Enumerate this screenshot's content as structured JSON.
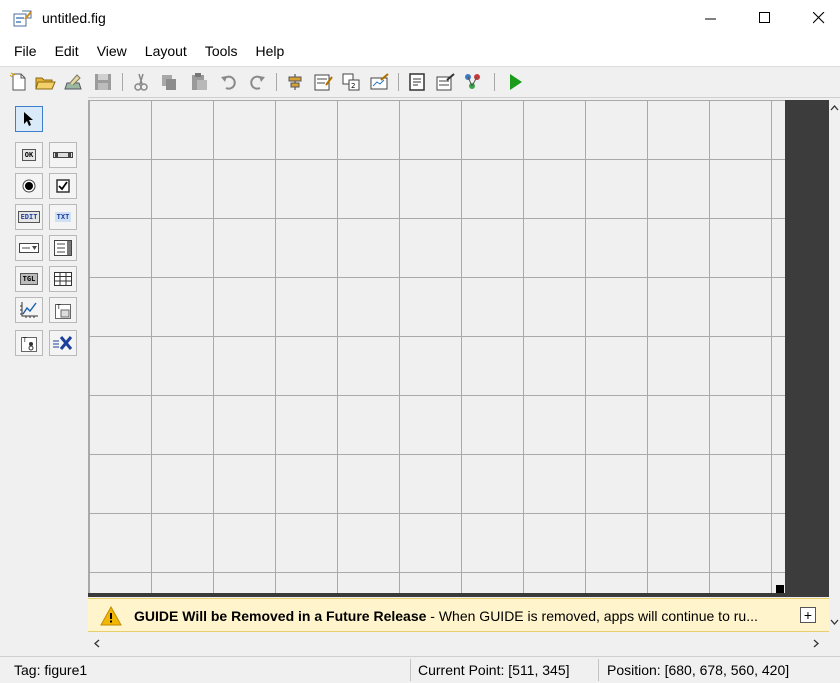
{
  "window": {
    "title": "untitled.fig"
  },
  "menu": [
    "File",
    "Edit",
    "View",
    "Layout",
    "Tools",
    "Help"
  ],
  "toolbar": {
    "icons": [
      "new-icon",
      "open-icon",
      "save-icon",
      "cut-icon",
      "copy-icon",
      "paste-icon",
      "undo-icon",
      "redo-icon",
      "align-icon",
      "menu-editor-icon",
      "tab-order-icon",
      "toolbar-editor-icon",
      "editor-icon",
      "property-inspector-icon",
      "object-browser-icon",
      "run-icon"
    ]
  },
  "palette": {
    "labels": {
      "pushbutton": "OK",
      "edit": "EDIT",
      "text": "TXT",
      "toggle": "TGL"
    }
  },
  "banner": {
    "title": "GUIDE Will be Removed in a Future Release",
    "message": " - When GUIDE is removed, apps will continue to ru...",
    "expand": "+"
  },
  "status": {
    "tag": "Tag: figure1",
    "current_point": "Current Point:  [511, 345]",
    "position": "Position: [680, 678, 560, 420]"
  },
  "colors": {
    "accent": "#3c7fd1",
    "run": "#1a9c1a",
    "banner_bg": "#fff4cc",
    "warn": "#f2b705"
  }
}
